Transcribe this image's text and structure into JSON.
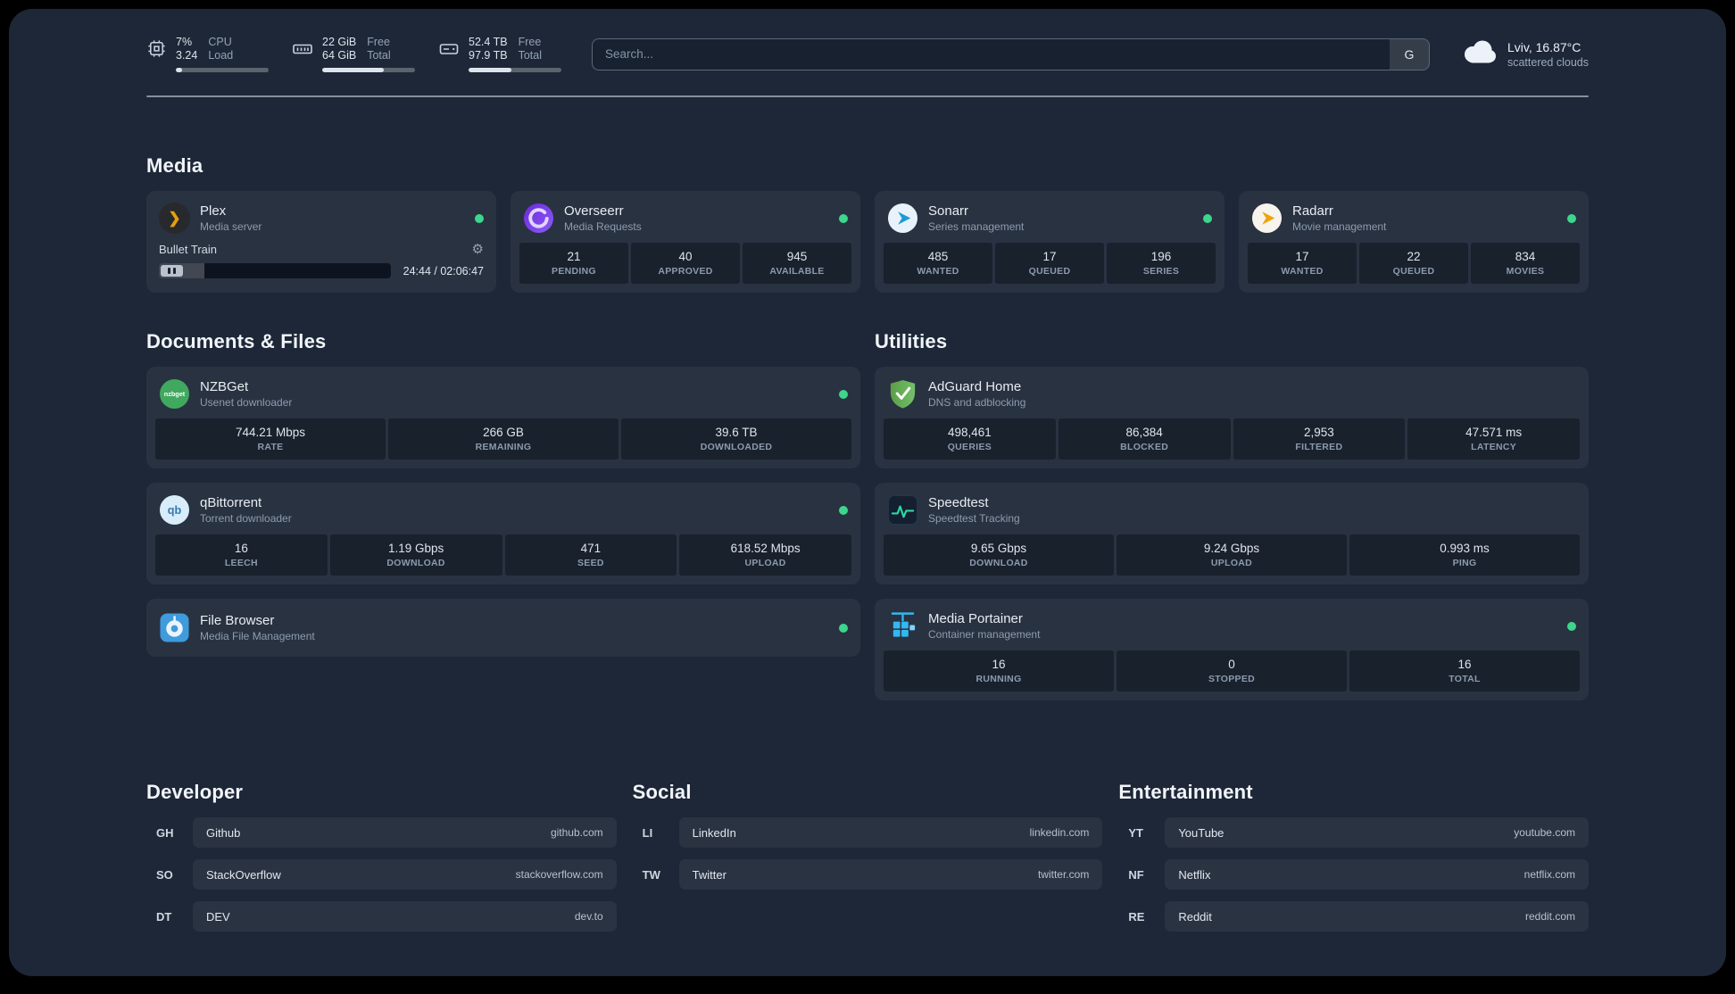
{
  "system": {
    "cpu": {
      "value1": "7%",
      "value2": "3.24",
      "label1": "CPU",
      "label2": "Load",
      "percent": 7
    },
    "memory": {
      "value1": "22 GiB",
      "value2": "64 GiB",
      "label1": "Free",
      "label2": "Total",
      "percent": 66
    },
    "disk": {
      "value1": "52.4 TB",
      "value2": "97.9 TB",
      "label1": "Free",
      "label2": "Total",
      "percent": 46
    }
  },
  "search": {
    "placeholder": "Search...",
    "provider_button": "G"
  },
  "weather": {
    "location": "Lviv, 16.87°C",
    "condition": "scattered clouds"
  },
  "sections": {
    "media": {
      "title": "Media"
    },
    "documents": {
      "title": "Documents & Files"
    },
    "utilities": {
      "title": "Utilities"
    },
    "developer": {
      "title": "Developer"
    },
    "social": {
      "title": "Social"
    },
    "entertainment": {
      "title": "Entertainment"
    }
  },
  "services": {
    "plex": {
      "name": "Plex",
      "desc": "Media server",
      "status": "online",
      "player": {
        "title": "Bullet Train",
        "time": "24:44 / 02:06:47",
        "progress_percent": 19.5
      }
    },
    "overseerr": {
      "name": "Overseerr",
      "desc": "Media Requests",
      "status": "online",
      "stats": [
        {
          "value": "21",
          "label": "PENDING"
        },
        {
          "value": "40",
          "label": "APPROVED"
        },
        {
          "value": "945",
          "label": "AVAILABLE"
        }
      ]
    },
    "sonarr": {
      "name": "Sonarr",
      "desc": "Series management",
      "status": "online",
      "stats": [
        {
          "value": "485",
          "label": "WANTED"
        },
        {
          "value": "17",
          "label": "QUEUED"
        },
        {
          "value": "196",
          "label": "SERIES"
        }
      ]
    },
    "radarr": {
      "name": "Radarr",
      "desc": "Movie management",
      "status": "online",
      "stats": [
        {
          "value": "17",
          "label": "WANTED"
        },
        {
          "value": "22",
          "label": "QUEUED"
        },
        {
          "value": "834",
          "label": "MOVIES"
        }
      ]
    },
    "nzbget": {
      "name": "NZBGet",
      "desc": "Usenet downloader",
      "status": "online",
      "stats": [
        {
          "value": "744.21 Mbps",
          "label": "RATE"
        },
        {
          "value": "266 GB",
          "label": "REMAINING"
        },
        {
          "value": "39.6 TB",
          "label": "DOWNLOADED"
        }
      ]
    },
    "qbittorrent": {
      "name": "qBittorrent",
      "desc": "Torrent downloader",
      "status": "online",
      "stats": [
        {
          "value": "16",
          "label": "LEECH"
        },
        {
          "value": "1.19 Gbps",
          "label": "DOWNLOAD"
        },
        {
          "value": "471",
          "label": "SEED"
        },
        {
          "value": "618.52 Mbps",
          "label": "UPLOAD"
        }
      ]
    },
    "filebrowser": {
      "name": "File Browser",
      "desc": "Media File Management",
      "status": "online"
    },
    "adguard": {
      "name": "AdGuard Home",
      "desc": "DNS and adblocking",
      "stats": [
        {
          "value": "498,461",
          "label": "QUERIES"
        },
        {
          "value": "86,384",
          "label": "BLOCKED"
        },
        {
          "value": "2,953",
          "label": "FILTERED"
        },
        {
          "value": "47.571 ms",
          "label": "LATENCY"
        }
      ]
    },
    "speedtest": {
      "name": "Speedtest",
      "desc": "Speedtest Tracking",
      "stats": [
        {
          "value": "9.65 Gbps",
          "label": "DOWNLOAD"
        },
        {
          "value": "9.24 Gbps",
          "label": "UPLOAD"
        },
        {
          "value": "0.993 ms",
          "label": "PING"
        }
      ]
    },
    "portainer": {
      "name": "Media Portainer",
      "desc": "Container management",
      "status": "online",
      "stats": [
        {
          "value": "16",
          "label": "RUNNING"
        },
        {
          "value": "0",
          "label": "STOPPED"
        },
        {
          "value": "16",
          "label": "TOTAL"
        }
      ]
    }
  },
  "bookmarks": {
    "developer": [
      {
        "abbr": "GH",
        "name": "Github",
        "url": "github.com"
      },
      {
        "abbr": "SO",
        "name": "StackOverflow",
        "url": "stackoverflow.com"
      },
      {
        "abbr": "DT",
        "name": "DEV",
        "url": "dev.to"
      }
    ],
    "social": [
      {
        "abbr": "LI",
        "name": "LinkedIn",
        "url": "linkedin.com"
      },
      {
        "abbr": "TW",
        "name": "Twitter",
        "url": "twitter.com"
      }
    ],
    "entertainment": [
      {
        "abbr": "YT",
        "name": "YouTube",
        "url": "youtube.com"
      },
      {
        "abbr": "NF",
        "name": "Netflix",
        "url": "netflix.com"
      },
      {
        "abbr": "RE",
        "name": "Reddit",
        "url": "reddit.com"
      }
    ]
  },
  "colors": {
    "background": "#1d2737",
    "status_online": "#3dd68c",
    "plex_accent": "#e5a00d"
  }
}
